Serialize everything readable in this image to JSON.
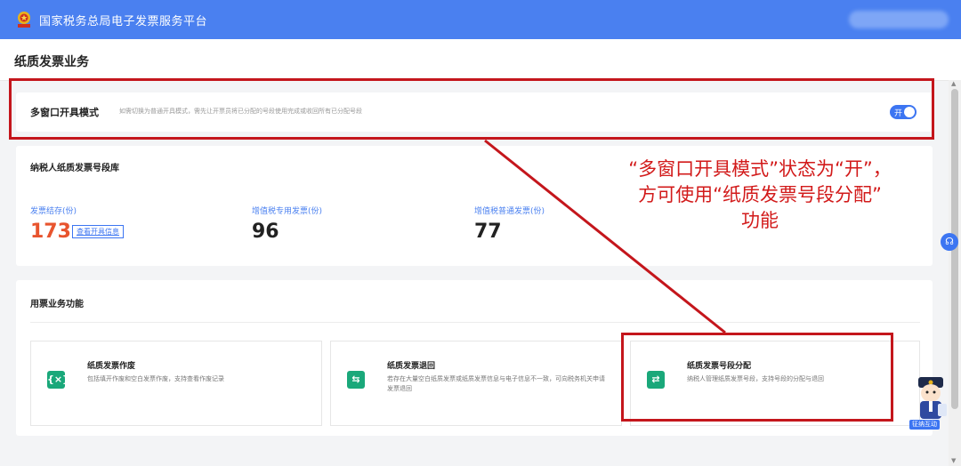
{
  "header": {
    "app_title": "国家税务总局电子发票服务平台",
    "logo_icon": "tax-emblem-icon",
    "accent_color": "#4a80f0"
  },
  "page": {
    "title": "纸质发票业务"
  },
  "multi_window": {
    "title": "多窗口开具模式",
    "hint": "如需切换为普通开具模式，需先让开票员将已分配的号段使用完成或收回所有已分配号段",
    "toggle_label": "开",
    "toggle_on": true
  },
  "stock": {
    "title": "纳税人纸质发票号段库",
    "stats": [
      {
        "label": "发票结存(份)",
        "value": "173",
        "link": "查看开具信息"
      },
      {
        "label": "增值税专用发票(份)",
        "value": "96"
      },
      {
        "label": "增值税普通发票(份)",
        "value": "77"
      }
    ]
  },
  "functions": {
    "title": "用票业务功能",
    "items": [
      {
        "title": "纸质发票作废",
        "desc": "包括填开作废和空白发票作废，支持查看作废记录",
        "icon": "void-invoice-icon",
        "glyph": "{×}"
      },
      {
        "title": "纸质发票退回",
        "desc": "若存在大量空白纸质发票或纸质发票信息与电子信息不一致，可向税务机关申请发票退回",
        "icon": "return-invoice-icon",
        "glyph": "⇆"
      },
      {
        "title": "纸质发票号段分配",
        "desc": "纳税人管理纸质发票号段，支持号段的分配与退回",
        "icon": "allocate-segment-icon",
        "glyph": "⇄"
      }
    ]
  },
  "assistant": {
    "label": "征纳互动",
    "icon": "tax-assistant-avatar-icon"
  },
  "annotation": {
    "lines": [
      "“多窗口开具模式”状态为“开”，",
      "方可使用“纸质发票号段分配”",
      "功能"
    ],
    "color": "#d21a1a"
  }
}
